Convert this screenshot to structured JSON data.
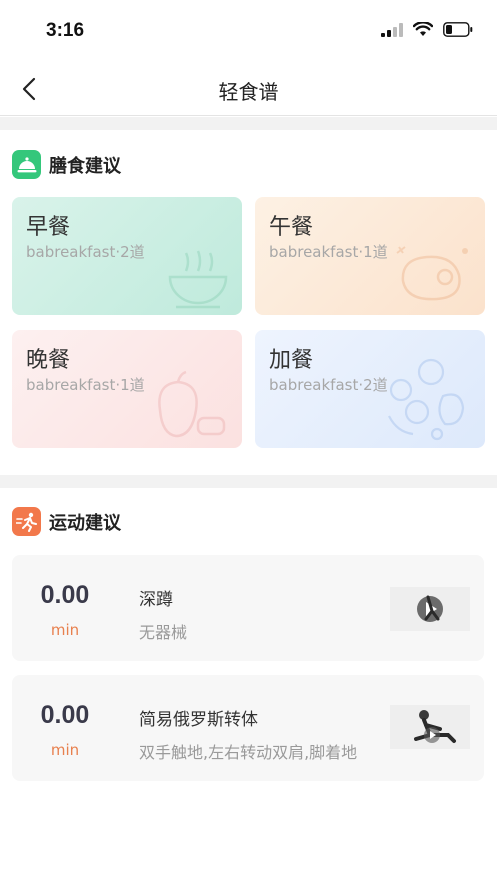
{
  "status": {
    "time": "3:16"
  },
  "nav": {
    "title": "轻食谱"
  },
  "diet": {
    "title": "膳食建议",
    "meals": [
      {
        "name": "早餐",
        "sub": "babreakfast·2道",
        "color_from": "#d9f3ea",
        "color_to": "#bfeadc"
      },
      {
        "name": "午餐",
        "sub": "babreakfast·1道",
        "color_from": "#fdf1e4",
        "color_to": "#fbe2cc"
      },
      {
        "name": "晚餐",
        "sub": "babreakfast·1道",
        "color_from": "#fdf0f0",
        "color_to": "#fbe1e0"
      },
      {
        "name": "加餐",
        "sub": "babreakfast·2道",
        "color_from": "#eef4fe",
        "color_to": "#dde9fb"
      }
    ]
  },
  "exercise": {
    "title": "运动建议",
    "items": [
      {
        "value": "0.00",
        "unit": "min",
        "name": "深蹲",
        "desc": "无器械"
      },
      {
        "value": "0.00",
        "unit": "min",
        "name": "简易俄罗斯转体",
        "desc": "双手触地,左右转动双肩,脚着地"
      }
    ]
  },
  "colors": {
    "diet_icon": "#34c77b",
    "exercise_icon": "#f2784b",
    "accent_unit": "#e8804e"
  }
}
